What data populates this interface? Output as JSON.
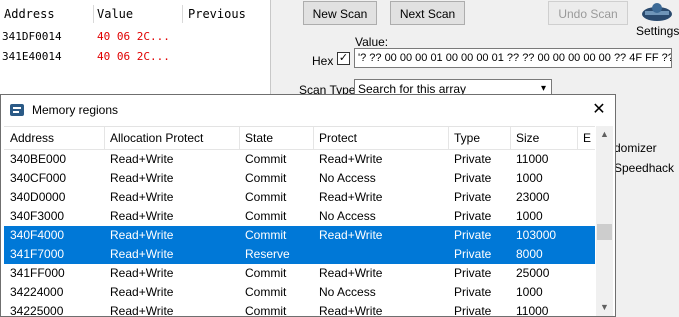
{
  "found_list": {
    "columns": [
      "Address",
      "Value",
      "Previous"
    ],
    "rows": [
      {
        "address": "341DF0014",
        "value": "40 06 2C..."
      },
      {
        "address": "341E40014",
        "value": "40 06 2C..."
      }
    ]
  },
  "toolbar": {
    "new_scan": "New Scan",
    "next_scan": "Next Scan",
    "undo_scan": "Undo Scan",
    "settings": "Settings"
  },
  "scan": {
    "value_label": "Value:",
    "hex_label": "Hex",
    "hex_checked": "✓",
    "value": "'? ?? 00 00 00 01 00 00 00 01 ?? ?? 00 00 00 00 00 ?? 4F FF ?? ??",
    "scan_type_label": "Scan Type",
    "scan_type": "Search for this array"
  },
  "side_options": {
    "randomizer": "domizer",
    "speedhack": "Speedhack"
  },
  "dialog": {
    "title": "Memory regions",
    "close_symbol": "✕",
    "columns": [
      "Address",
      "Allocation Protect",
      "State",
      "Protect",
      "Type",
      "Size",
      "E"
    ],
    "rows": [
      {
        "address": "340BE000",
        "alloc": "Read+Write",
        "state": "Commit",
        "protect": "Read+Write",
        "type": "Private",
        "size": "11000"
      },
      {
        "address": "340CF000",
        "alloc": "Read+Write",
        "state": "Commit",
        "protect": "No Access",
        "type": "Private",
        "size": "1000"
      },
      {
        "address": "340D0000",
        "alloc": "Read+Write",
        "state": "Commit",
        "protect": "Read+Write",
        "type": "Private",
        "size": "23000"
      },
      {
        "address": "340F3000",
        "alloc": "Read+Write",
        "state": "Commit",
        "protect": "No Access",
        "type": "Private",
        "size": "1000"
      },
      {
        "address": "340F4000",
        "alloc": "Read+Write",
        "state": "Commit",
        "protect": "Read+Write",
        "type": "Private",
        "size": "103000"
      },
      {
        "address": "341F7000",
        "alloc": "Read+Write",
        "state": "Reserve",
        "protect": "",
        "type": "Private",
        "size": "8000"
      },
      {
        "address": "341FF000",
        "alloc": "Read+Write",
        "state": "Commit",
        "protect": "Read+Write",
        "type": "Private",
        "size": "25000"
      },
      {
        "address": "34224000",
        "alloc": "Read+Write",
        "state": "Commit",
        "protect": "No Access",
        "type": "Private",
        "size": "1000"
      },
      {
        "address": "34225000",
        "alloc": "Read+Write",
        "state": "Commit",
        "protect": "Read+Write",
        "type": "Private",
        "size": "11000"
      }
    ],
    "selected_rows": [
      4,
      5
    ]
  },
  "icons": {
    "dialog_icon": "cheat-engine-icon",
    "logo": "cheat-engine-logo",
    "scroll_up": "chevron-up-icon",
    "scroll_down": "chevron-down-icon",
    "dropdown": "chevron-down-icon"
  },
  "colors": {
    "selection": "#0078d7",
    "found_value": "#e00000"
  }
}
